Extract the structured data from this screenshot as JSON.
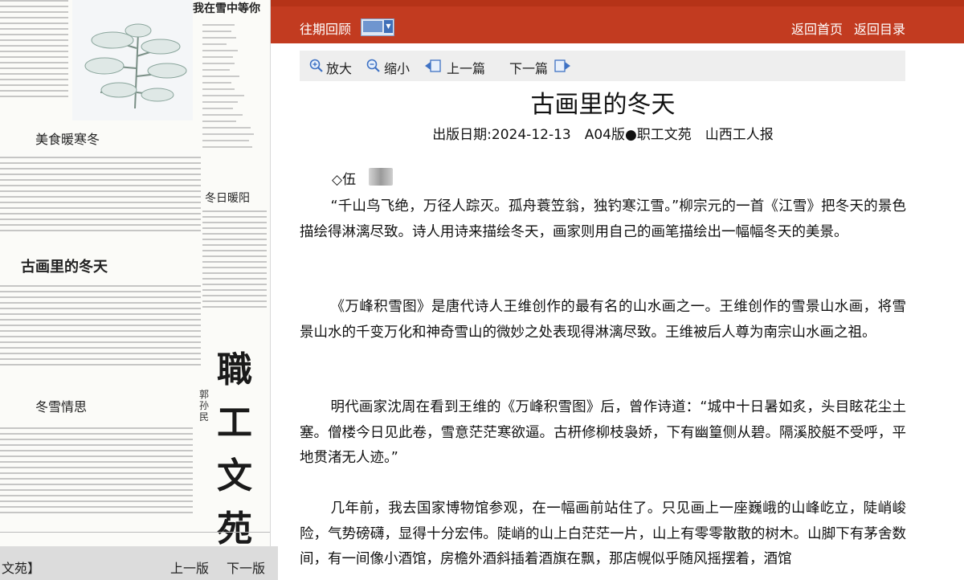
{
  "topbar": {
    "history_label": "往期回顾",
    "home_label": "返回首页",
    "toc_label": "返回目录"
  },
  "toolbar": {
    "zoom_in": "放大",
    "zoom_out": "缩小",
    "prev_article": "上一篇",
    "next_article": "下一篇"
  },
  "article": {
    "title": "古画里的冬天",
    "meta": "出版日期:2024-12-13　A04版●职工文苑　山西工人报",
    "author": "◇伍",
    "paragraphs": [
      "“千山鸟飞绝，万径人踪灭。孤舟蓑笠翁，独钓寒江雪。”柳宗元的一首《江雪》把冬天的景色描绘得淋漓尽致。诗人用诗来描绘冬天，画家则用自己的画笔描绘出一幅幅冬天的美景。",
      "《万峰积雪图》是唐代诗人王维创作的最有名的山水画之一。王维创作的雪景山水画，将雪景山水的千变万化和神奇雪山的微妙之处表现得淋漓尽致。王维被后人尊为南宗山水画之祖。",
      "明代画家沈周在看到王维的《万峰积雪图》后，曾作诗道：“城中十日暑如炙，头目眩花尘土塞。僧楼今日见此卷，雪意茫茫寒欲逼。古枅修柳枝袅娇，下有幽篁侧从碧。隔溪胶艇不受呼，平地贯渚无人迹。”",
      "几年前，我去国家博物馆参观，在一幅画前站住了。只见画上一座巍峨的山峰屹立，陡峭峻险，气势磅礴，显得十分宏伟。陡峭的山上白茫茫一片，山上有零零散散的树木。山脚下有茅舍数间，有一间像小酒馆，房檐外酒斜插着酒旗在飘，那店幌似乎随风摇摆着，酒馆"
    ]
  },
  "newspaper": {
    "headline_wait": "我在雪中等你",
    "headline_food": "美食暖寒冬",
    "headline_paint": "古画里的冬天",
    "headline_sun": "冬日暖阳",
    "headline_snow": "冬雪情思",
    "calligraphy": "職工文苑",
    "signature": "郭孙民",
    "page_nav": {
      "section_label": "文苑】",
      "prev_page": "上一版",
      "next_page": "下一版"
    }
  }
}
